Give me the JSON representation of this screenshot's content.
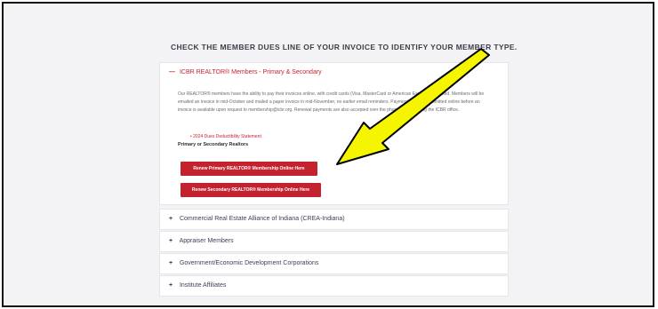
{
  "page": {
    "heading": "CHECK THE MEMBER DUES LINE OF YOUR INVOICE TO IDENTIFY YOUR MEMBER TYPE."
  },
  "accordion": {
    "open_symbol": "—",
    "closed_symbol": "+",
    "icbr": {
      "title": "ICBR REALTOR® Members - Primary & Secondary",
      "body": "Our REALTOR® members have the ability to pay their invoices online, with credit cards (Visa, MasterCard or American Express) accepted. Members will be emailed an invoice in mid-October and mailed a paper invoice in mid-November, no earlier email reminders. Payments may be submitted online before an invoice is available upon request to membership@icbr.org. Renewal payments are also accepted over the phone by contacting the ICBR office.",
      "link": "2024 Dues Deductibility Statement",
      "subheading": "Primary or Secondary Realtors",
      "btn_primary": "Renew Primary REALTOR® Membership Online Here",
      "btn_secondary": "Renew Secondary REALTOR® Membership Online Here"
    },
    "crea": {
      "title": "Commercial Real Estate Alliance of Indiana (CREA-Indiana)"
    },
    "appraiser": {
      "title": "Appraiser Members"
    },
    "government": {
      "title": "Government/Economic Development Corporations"
    },
    "institute": {
      "title": "Institute Affiliates"
    }
  },
  "annotation": {
    "arrow_color": "#f5f500"
  }
}
